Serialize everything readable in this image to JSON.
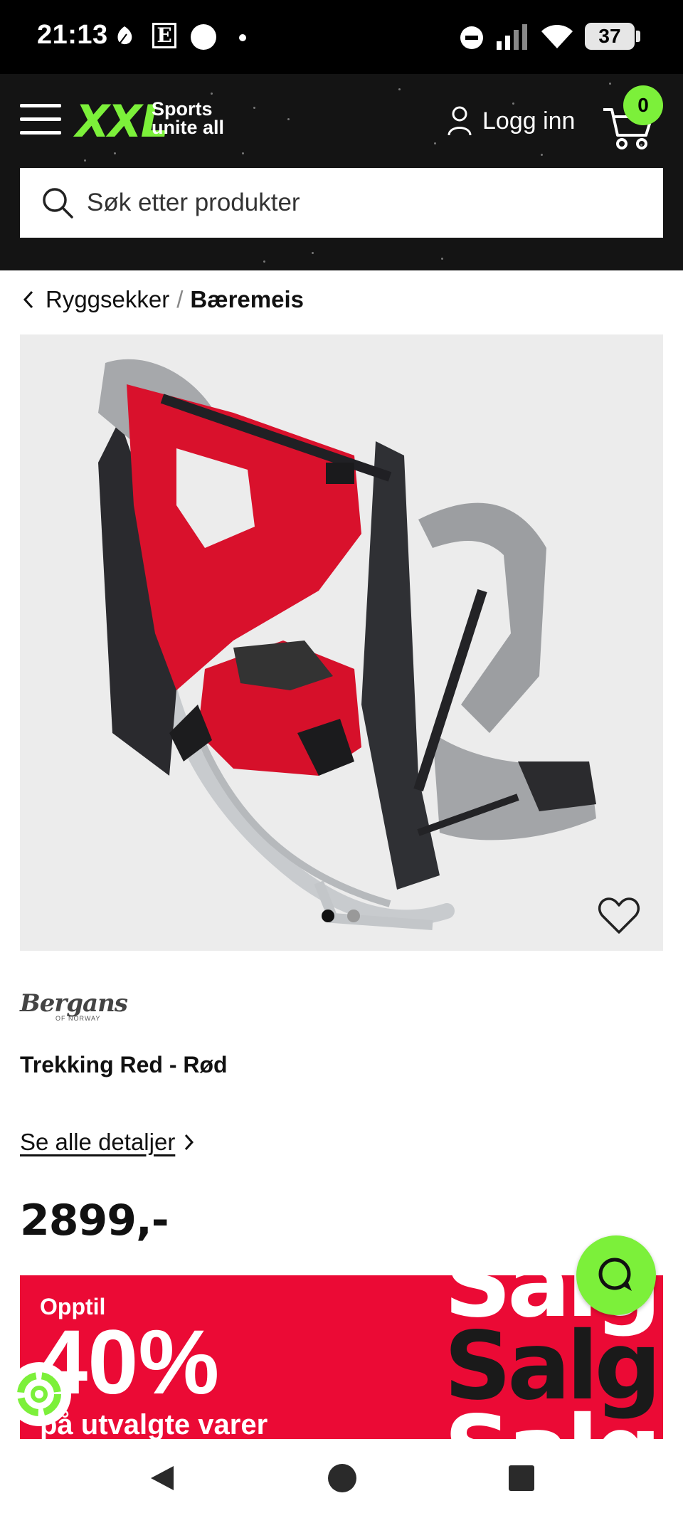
{
  "status_bar": {
    "time": "21:13",
    "battery": "37",
    "icons": [
      "leaf-icon",
      "e-paper-icon",
      "circle-icon",
      "dot-icon",
      "do-not-disturb-icon",
      "signal-icon",
      "wifi-icon",
      "battery-icon"
    ]
  },
  "header": {
    "menu_icon": "hamburger-icon",
    "logo_text": "XXL",
    "logo_tagline_1": "Sports",
    "logo_tagline_2": "unite all",
    "login_label": "Logg inn",
    "cart_count": "0",
    "search_placeholder": "Søk etter produkter",
    "accent": "#7cf03a"
  },
  "breadcrumb": {
    "parent": "Ryggsekker",
    "separator": "/",
    "current": "Bæremeis"
  },
  "gallery": {
    "image_count": 2,
    "active_index": 0
  },
  "product": {
    "brand": "Bergans",
    "brand_sub": "OF NORWAY",
    "title": "Trekking Red - Rød",
    "details_link": "Se alle detaljer",
    "price": "2899,-"
  },
  "banner": {
    "upto": "Opptil",
    "percent": "40%",
    "description": "på utvalgte varer",
    "salg_1": "Salg",
    "salg_2": "Salg",
    "salg_3": "Salg",
    "color": "#eb0a35"
  },
  "nav_bar": {
    "back": "back-icon",
    "home": "home-icon",
    "recents": "recents-icon"
  }
}
